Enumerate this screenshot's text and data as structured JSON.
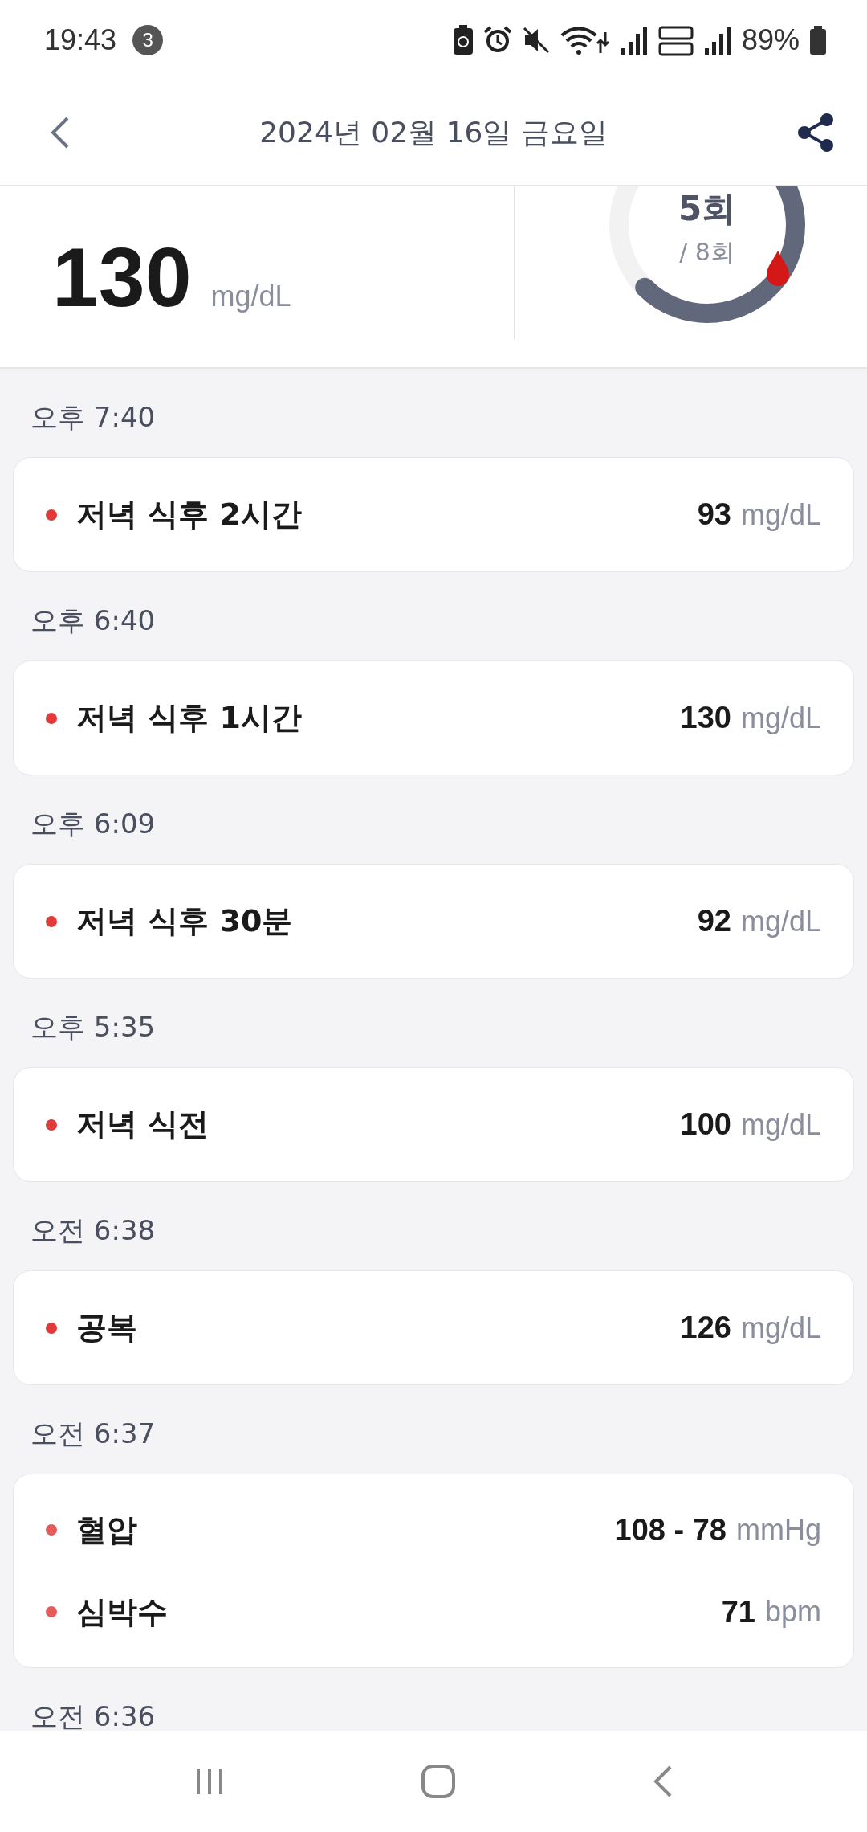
{
  "status_bar": {
    "time": "19:43",
    "notification_count": "3",
    "battery": "89%"
  },
  "header": {
    "title": "2024년 02월 16일 금요일"
  },
  "summary": {
    "value": "130",
    "unit": "mg/dL",
    "count": "5회",
    "total": "/ 8회"
  },
  "entries": [
    {
      "time": "오후 7:40",
      "items": [
        {
          "label": "저녁 식후 2시간",
          "value": "93",
          "unit": "mg/dL"
        }
      ]
    },
    {
      "time": "오후 6:40",
      "items": [
        {
          "label": "저녁 식후 1시간",
          "value": "130",
          "unit": "mg/dL"
        }
      ]
    },
    {
      "time": "오후 6:09",
      "items": [
        {
          "label": "저녁 식후 30분",
          "value": "92",
          "unit": "mg/dL"
        }
      ]
    },
    {
      "time": "오후 5:35",
      "items": [
        {
          "label": "저녁 식전",
          "value": "100",
          "unit": "mg/dL"
        }
      ]
    },
    {
      "time": "오전 6:38",
      "items": [
        {
          "label": "공복",
          "value": "126",
          "unit": "mg/dL"
        }
      ]
    },
    {
      "time": "오전 6:37",
      "items": [
        {
          "label": "혈압",
          "value": "108 - 78",
          "unit": "mmHg"
        },
        {
          "label": "심박수",
          "value": "71",
          "unit": "bpm"
        }
      ]
    },
    {
      "time": "오전 6:36"
    }
  ]
}
